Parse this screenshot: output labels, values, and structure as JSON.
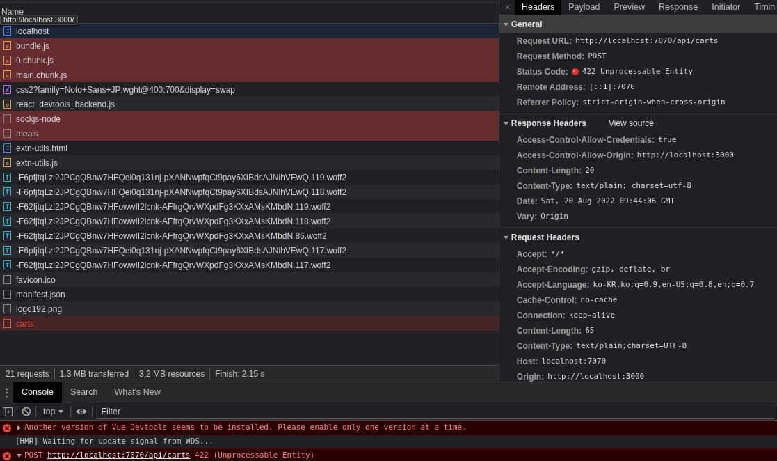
{
  "network": {
    "column_header": "Name",
    "tooltip": "http://localhost:3000/",
    "requests": [
      {
        "name": "localhost",
        "kind": "document",
        "failed": false,
        "hovered": true,
        "selected": false
      },
      {
        "name": "bundle.js",
        "kind": "script",
        "failed": true,
        "selected": false
      },
      {
        "name": "0.chunk.js",
        "kind": "script",
        "failed": true,
        "selected": false
      },
      {
        "name": "main.chunk.js",
        "kind": "script",
        "failed": true,
        "selected": false
      },
      {
        "name": "css2?family=Noto+Sans+JP:wght@400;700&display=swap",
        "kind": "stylesheet",
        "failed": false,
        "selected": false
      },
      {
        "name": "react_devtools_backend.js",
        "kind": "script",
        "failed": false,
        "selected": false
      },
      {
        "name": "sockjs-node",
        "kind": "other",
        "failed": true,
        "selected": false
      },
      {
        "name": "meals",
        "kind": "other",
        "failed": true,
        "selected": false
      },
      {
        "name": "extn-utils.html",
        "kind": "document",
        "failed": false,
        "selected": false
      },
      {
        "name": "extn-utils.js",
        "kind": "script",
        "failed": false,
        "selected": false
      },
      {
        "name": "-F6pfjtqLzl2JPCgQBnw7HFQei0q131nj-pXANNwpfqCt9pay6XIBdsAJNlhVEwQ.119.woff2",
        "kind": "font",
        "failed": false,
        "selected": false
      },
      {
        "name": "-F6pfjtqLzl2JPCgQBnw7HFQei0q131nj-pXANNwpfqCt9pay6XIBdsAJNlhVEwQ.118.woff2",
        "kind": "font",
        "failed": false,
        "selected": false
      },
      {
        "name": "-F62fjtqLzl2JPCgQBnw7HFowwII2lcnk-AFfrgQrvWXpdFg3KXxAMsKMbdN.119.woff2",
        "kind": "font",
        "failed": false,
        "selected": false
      },
      {
        "name": "-F62fjtqLzl2JPCgQBnw7HFowwII2lcnk-AFfrgQrvWXpdFg3KXxAMsKMbdN.118.woff2",
        "kind": "font",
        "failed": false,
        "selected": false
      },
      {
        "name": "-F62fjtqLzl2JPCgQBnw7HFowwII2lcnk-AFfrgQrvWXpdFg3KXxAMsKMbdN.86.woff2",
        "kind": "font",
        "failed": false,
        "selected": false
      },
      {
        "name": "-F6pfjtqLzl2JPCgQBnw7HFQei0q131nj-pXANNwpfqCt9pay6XIBdsAJNlhVEwQ.117.woff2",
        "kind": "font",
        "failed": false,
        "selected": false
      },
      {
        "name": "-F62fjtqLzl2JPCgQBnw7HFowwII2lcnk-AFfrgQrvWXpdFg3KXxAMsKMbdN.117.woff2",
        "kind": "font",
        "failed": false,
        "selected": false
      },
      {
        "name": "favicon.ico",
        "kind": "other",
        "failed": false,
        "selected": false
      },
      {
        "name": "manifest.json",
        "kind": "other",
        "failed": false,
        "selected": false
      },
      {
        "name": "logo192.png",
        "kind": "other",
        "failed": false,
        "selected": false
      },
      {
        "name": "carts",
        "kind": "other",
        "failed": true,
        "selected": true
      }
    ],
    "summary": [
      "21 requests",
      "1.3 MB transferred",
      "3.2 MB resources",
      "Finish: 2.15 s"
    ]
  },
  "details": {
    "close": "×",
    "tabs": [
      {
        "label": "Headers",
        "selected": true
      },
      {
        "label": "Payload",
        "selected": false
      },
      {
        "label": "Preview",
        "selected": false
      },
      {
        "label": "Response",
        "selected": false
      },
      {
        "label": "Initiator",
        "selected": false
      },
      {
        "label": "Timin",
        "selected": false
      }
    ],
    "sections": [
      {
        "title": "General",
        "expanded": true,
        "highlighted": true,
        "headers": [
          {
            "name": "Request URL:",
            "value": "http://localhost:7070/api/carts"
          },
          {
            "name": "Request Method:",
            "value": "POST"
          },
          {
            "name": "Status Code:",
            "value": "422 Unprocessable Entity",
            "failed": true
          },
          {
            "name": "Remote Address:",
            "value": "[::1]:7070"
          },
          {
            "name": "Referrer Policy:",
            "value": "strict-origin-when-cross-origin"
          }
        ]
      },
      {
        "title": "Response Headers",
        "expanded": true,
        "highlighted": false,
        "link": "View source",
        "headers": [
          {
            "name": "Access-Control-Allow-Credentials:",
            "value": "true"
          },
          {
            "name": "Access-Control-Allow-Origin:",
            "value": "http://localhost:3000"
          },
          {
            "name": "Content-Length:",
            "value": "20"
          },
          {
            "name": "Content-Type:",
            "value": "text/plain; charset=utf-8"
          },
          {
            "name": "Date:",
            "value": "Sat, 20 Aug 2022 09:44:06 GMT"
          },
          {
            "name": "Vary:",
            "value": "Origin"
          }
        ]
      },
      {
        "title": "Request Headers",
        "expanded": true,
        "highlighted": false,
        "headers": [
          {
            "name": "Accept:",
            "value": "*/*"
          },
          {
            "name": "Accept-Encoding:",
            "value": "gzip, deflate, br"
          },
          {
            "name": "Accept-Language:",
            "value": "ko-KR,ko;q=0.9,en-US;q=0.8,en;q=0.7"
          },
          {
            "name": "Cache-Control:",
            "value": "no-cache"
          },
          {
            "name": "Connection:",
            "value": "keep-alive"
          },
          {
            "name": "Content-Length:",
            "value": "65"
          },
          {
            "name": "Content-Type:",
            "value": "text/plain;charset=UTF-8"
          },
          {
            "name": "Host:",
            "value": "localhost:7070"
          },
          {
            "name": "Origin:",
            "value": "http://localhost:3000"
          }
        ]
      }
    ]
  },
  "drawer": {
    "tabs": [
      {
        "label": "Console",
        "selected": true
      },
      {
        "label": "Search",
        "selected": false
      },
      {
        "label": "What's New",
        "selected": false
      }
    ],
    "context": "top",
    "filter_placeholder": "Filter",
    "messages": [
      {
        "kind": "error",
        "expanded": false,
        "parts": [
          {
            "kind": "text",
            "text": "Another version of Vue Devtools seems to be installed. Please enable only one version at a time."
          }
        ]
      },
      {
        "kind": "info",
        "parts": [
          {
            "kind": "text",
            "text": "[HMR] Waiting for update signal from WDS..."
          }
        ]
      },
      {
        "kind": "error",
        "expanded": true,
        "parts": [
          {
            "kind": "text",
            "text": "POST "
          },
          {
            "kind": "link",
            "text": "http://localhost:7070/api/carts"
          },
          {
            "kind": "text",
            "text": " 422 (Unprocessable Entity)"
          }
        ]
      }
    ]
  }
}
